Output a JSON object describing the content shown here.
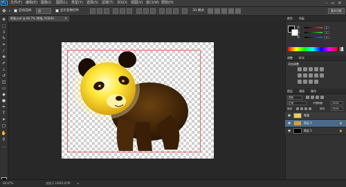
{
  "menubar": {
    "logo": "Ps",
    "items": [
      "文件(F)",
      "编辑(E)",
      "图像(I)",
      "图层(L)",
      "类型(Y)",
      "选择(S)",
      "滤镜(T)",
      "3D(D)",
      "视图(V)",
      "窗口(W)",
      "帮助(H)"
    ],
    "window_buttons": [
      "–",
      "▫",
      "✕"
    ]
  },
  "options": {
    "auto_select_label": "自动选择:",
    "auto_select_value": "组",
    "show_transform_label": "显示变换控件",
    "mode_label": "3D 模式:",
    "essentials_label": "基本功能"
  },
  "document": {
    "tab_title": "熊猫.psd @ 66.7% (熊猫, RGB/8)",
    "close_glyph": "×"
  },
  "status": {
    "zoom": "66.67%",
    "doc_info": "文档:1.31M/3.67M"
  },
  "panels": {
    "color_tabs": [
      "颜色",
      "色板"
    ],
    "slider_labels": [
      "R",
      "G",
      "B"
    ],
    "slider_values": [
      "0",
      "0",
      "0"
    ],
    "adjustments_tabs": [
      "调整",
      "样式"
    ],
    "adjustments_title": "添加调整",
    "layers_tabs": [
      "图层",
      "通道",
      "路径"
    ],
    "kind_label": "类型",
    "blend_mode": "正常",
    "opacity_label": "不透明度:",
    "opacity_value": "100%",
    "lock_label": "锁定:",
    "fill_label": "填充:",
    "fill_value": "100%",
    "layers": [
      {
        "name": "熊猫",
        "selected": false
      },
      {
        "name": "图层 0",
        "selected": true
      },
      {
        "name": "图层 1",
        "selected": false
      }
    ]
  },
  "colors": {
    "accent": "#31a8ff",
    "crop_frame": "#e06a6a",
    "red_slider": "#d23c3c",
    "green_slider": "#3cc83c",
    "blue_slider": "#3c5ad2"
  }
}
